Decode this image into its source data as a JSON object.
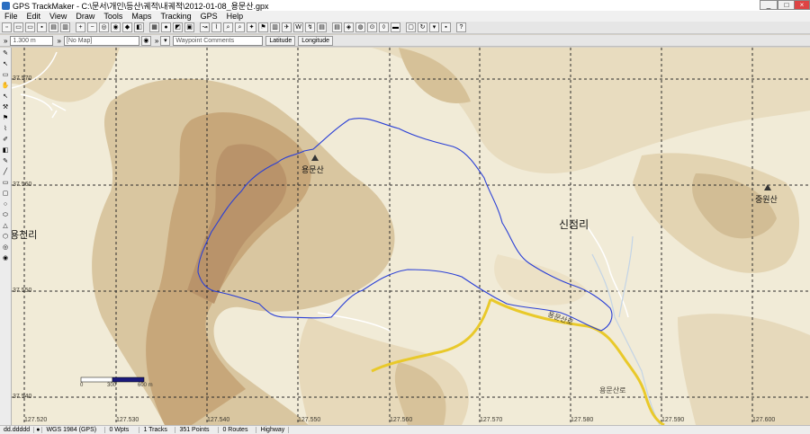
{
  "window": {
    "title": "GPS TrackMaker - C:\\문서\\개인\\등산\\궤적\\내궤적\\2012-01-08_용문산.gpx"
  },
  "menu": [
    "File",
    "Edit",
    "View",
    "Draw",
    "Tools",
    "Maps",
    "Tracking",
    "GPS",
    "Help"
  ],
  "toolbar2": {
    "scale": "1.300 m",
    "map": "[No Map]",
    "waypoint_comments": "Waypoint Comments",
    "latitude": "Latitude",
    "longitude": "Longitude"
  },
  "map": {
    "lat_labels": [
      "37.570",
      "37.560",
      "37.550",
      "37.540"
    ],
    "lon_labels": [
      "127.520",
      "127.530",
      "127.540",
      "127.550",
      "127.560",
      "127.570",
      "127.580",
      "127.590",
      "127.600"
    ],
    "places": [
      "용문산",
      "신점리",
      "중원산",
      "용천리"
    ],
    "roads": [
      "용문산로",
      "용문산로"
    ],
    "scale_bar": {
      "ticks": [
        "0",
        "300",
        "600 m"
      ]
    },
    "colors": {
      "track": "#2a3fd6",
      "road": "#e9c92a",
      "terrain_high": "#b9936a",
      "background": "#f1ebd7"
    }
  },
  "status": {
    "coords": "dd.ddddd",
    "datum": "WGS 1984 (GPS)",
    "wpts": "0 Wpts",
    "tracks": "1 Tracks",
    "points": "351 Points",
    "routes": "0 Routes",
    "road_type": "Highway"
  }
}
